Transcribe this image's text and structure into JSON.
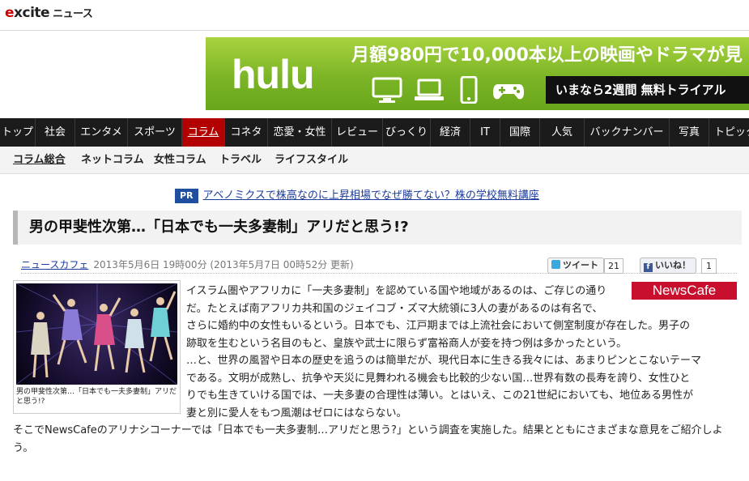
{
  "header": {
    "logo_e": "e",
    "logo_rest": "xcite",
    "logo_news": "ニュース"
  },
  "ad": {
    "brand": "hulu",
    "headline": "月額980円で10,000本以上の映画やドラマが見",
    "cta": "いまなら2週間 無料トライアル",
    "icons": [
      "tv-icon",
      "laptop-icon",
      "smartphone-icon",
      "gamepad-icon"
    ],
    "bg_color": "#7bb526"
  },
  "nav": {
    "items": [
      "トップ",
      "社会",
      "エンタメ",
      "スポーツ",
      "コラム",
      "コネタ",
      "恋愛・女性",
      "レビュー",
      "びっくり",
      "経済",
      "IT",
      "国際",
      "人気",
      "バックナンバー",
      "写真",
      "トピック"
    ],
    "active": "コラム",
    "active_color": "#b30000"
  },
  "subnav": {
    "items": [
      "コラム総合",
      "ネットコラム",
      "女性コラム",
      "トラベル",
      "ライフスタイル"
    ]
  },
  "pr": {
    "badge": "PR",
    "link": "アベノミクスで株高なのに上昇相場でなぜ勝てない？株の学校無料講座"
  },
  "article": {
    "title": "男の甲斐性次第…「日本でも一夫多妻制」アリだと思う!?",
    "source": "ニュースカフェ",
    "date": "2013年5月6日 19時00分 (2013年5月7日 00時52分 更新)",
    "tweet_label": "ツイート",
    "tweet_count": "21",
    "like_label": "いいね！",
    "like_count": "1",
    "caption": "男の甲斐性次第…「日本でも一夫多妻制」アリだと思う!?",
    "newscafe_logo": "NewsCafe",
    "lines": [
      "イスラム圏やアフリカに「一夫多妻制」を認めている国や地域があるのは、ご存じの通り",
      "だ。たとえば南アフリカ共和国のジェイコブ・ズマ大統領に3人の妻があるのは有名で、",
      "さらに婚約中の女性もいるという。日本でも、江戸期までは上流社会において側室制度が存在した。男子の",
      "跡取を生むという名目のもと、皇族や武士に限らず富裕商人が妾を持つ例は多かったという。",
      "…と、世界の風習や日本の歴史を追うのは簡単だが、現代日本に生きる我々には、あまりピンとこないテーマ",
      "である。文明が成熟し、抗争や天災に見舞われる機会も比較的少ない国…世界有数の長寿を誇り、女性ひと",
      "りでも生きていける国では、一夫多妻の合理性は薄い。とはいえ、この21世紀においても、地位ある男性が",
      "妻と別に愛人をもつ風潮はゼロにはならない。",
      "そこでNewsCafeのアリナシコーナーでは「日本でも一夫多妻制…アリだと思う?」という調査を実施した。結果とともにさまざまな意見をご紹介しよ",
      "う。"
    ]
  }
}
